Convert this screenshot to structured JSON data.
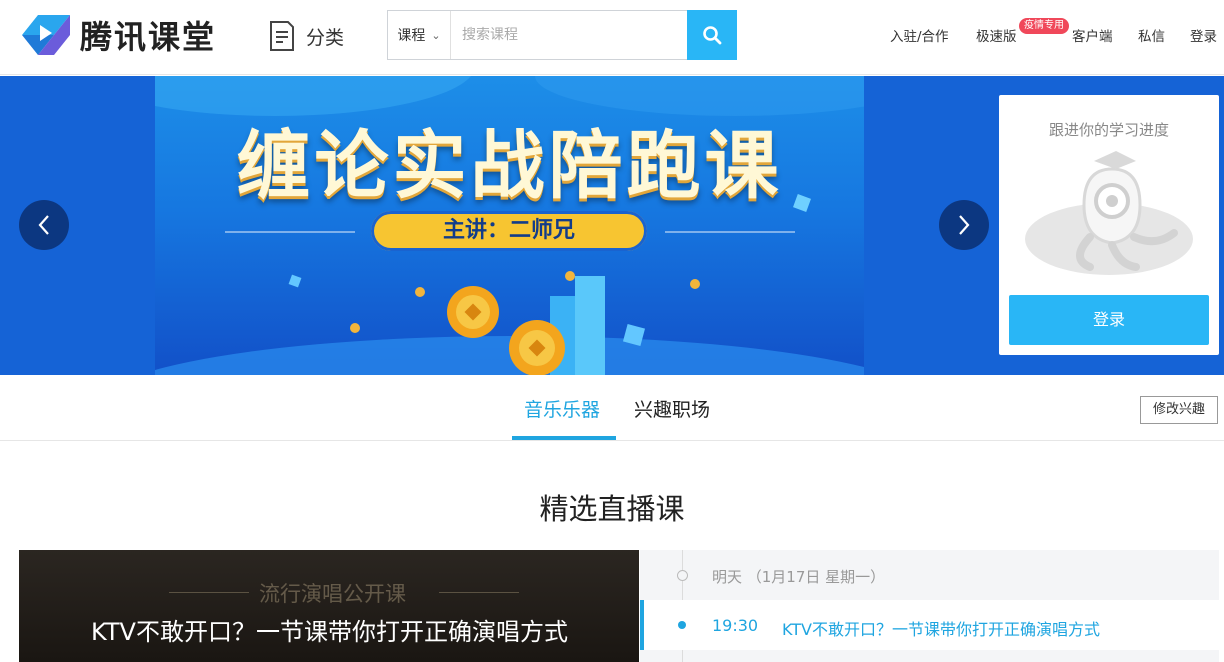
{
  "header": {
    "logo_text": "腾讯课堂",
    "category_label": "分类",
    "search": {
      "scope": "课程",
      "placeholder": "搜索课程",
      "value": ""
    },
    "nav": {
      "join": "入驻/合作",
      "lite": "极速版",
      "lite_badge": "疫情专用",
      "client": "客户端",
      "messages": "私信",
      "login": "登录"
    }
  },
  "banner": {
    "title": "缠论实战陪跑课",
    "subtitle": "主讲：二师兄"
  },
  "login_card": {
    "progress_text": "跟进你的学习进度",
    "login_button": "登录"
  },
  "tabs": {
    "items": [
      "音乐乐器",
      "兴趣职场"
    ],
    "active": "音乐乐器",
    "edit_button": "修改兴趣"
  },
  "live_section": {
    "title": "精选直播课",
    "featured": {
      "bg_caption": "流行演唱公开课",
      "title": "KTV不敢开口？一节课带你打开正确演唱方式"
    },
    "schedule": {
      "date_label": "明天  （1月17日 星期一）",
      "items": [
        {
          "time": "19:30",
          "title": "KTV不敢开口？一节课带你打开正确演唱方式"
        }
      ]
    }
  },
  "colors": {
    "accent": "#29b6f6",
    "tab_active": "#1fa5e0",
    "badge": "#f0485a",
    "banner_bg": "#1563d6"
  }
}
